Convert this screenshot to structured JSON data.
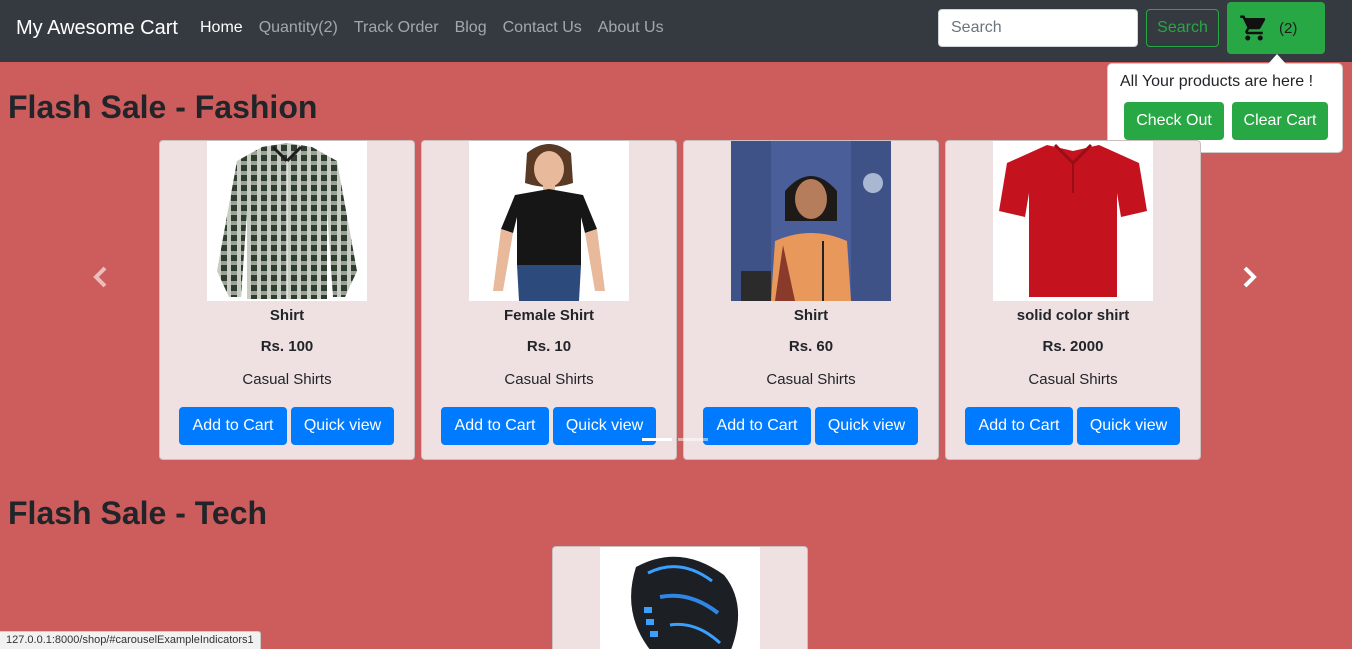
{
  "navbar": {
    "brand": "My Awesome Cart",
    "links": [
      "Home",
      "Quantity(2)",
      "Track Order",
      "Blog",
      "Contact Us",
      "About Us"
    ],
    "search_placeholder": "Search",
    "search_button": "Search",
    "cart_count": "(2)",
    "cart_icon": "shopping-cart-icon"
  },
  "popover": {
    "title": "All Your products are here !",
    "checkout_label": "Check Out",
    "clear_label": "Clear Cart"
  },
  "sections": {
    "fashion_title": "Flash Sale - Fashion",
    "tech_title": "Flash Sale - Tech"
  },
  "products": [
    {
      "name": "Shirt",
      "price": "Rs. 100",
      "category": "Casual Shirts",
      "add": "Add to Cart",
      "quick": "Quick view"
    },
    {
      "name": "Female Shirt",
      "price": "Rs. 10",
      "category": "Casual Shirts",
      "add": "Add to Cart",
      "quick": "Quick view"
    },
    {
      "name": "Shirt",
      "price": "Rs. 60",
      "category": "Casual Shirts",
      "add": "Add to Cart",
      "quick": "Quick view"
    },
    {
      "name": "solid color shirt",
      "price": "Rs. 2000",
      "category": "Casual Shirts",
      "add": "Add to Cart",
      "quick": "Quick view"
    }
  ],
  "colors": {
    "background": "#cd5c5c",
    "navbar": "#343a40",
    "success": "#28a745",
    "primary": "#007bff",
    "card": "#efe1e1"
  },
  "status_url": "127.0.0.1:8000/shop/#carouselExampleIndicators1"
}
